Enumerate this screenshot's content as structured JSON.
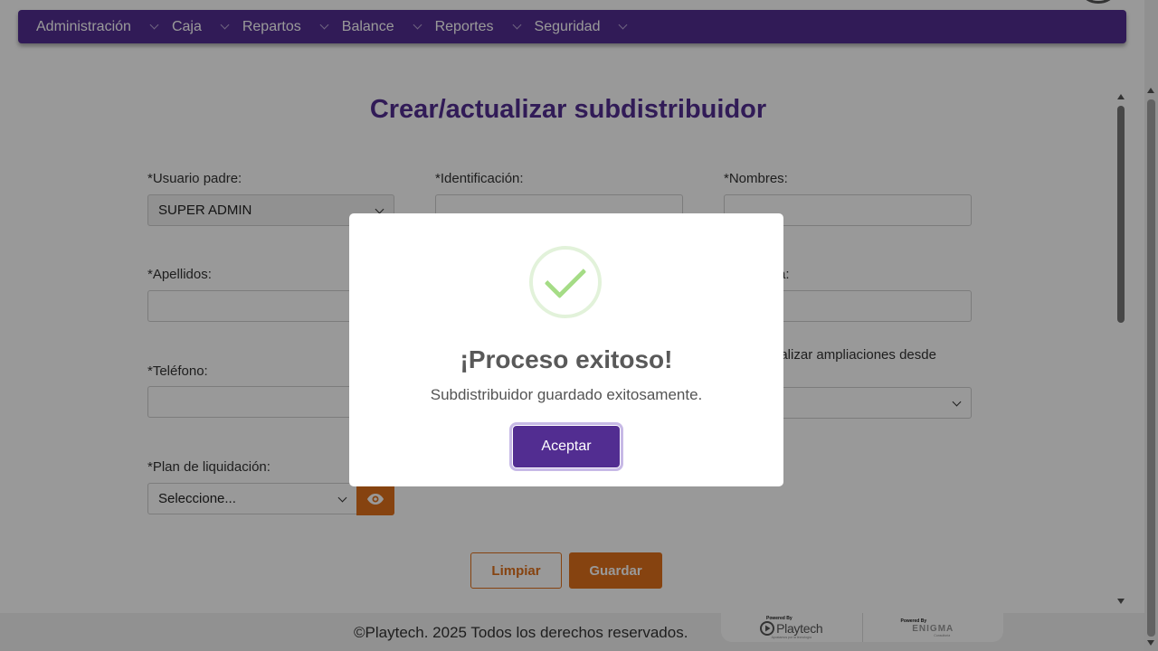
{
  "nav": {
    "items": [
      {
        "label": "Administración"
      },
      {
        "label": "Caja"
      },
      {
        "label": "Repartos"
      },
      {
        "label": "Balance"
      },
      {
        "label": "Reportes"
      },
      {
        "label": "Seguridad"
      }
    ]
  },
  "form": {
    "title": "Crear/actualizar subdistribuidor",
    "parent_user_label": "*Usuario padre:",
    "parent_user_value": "SUPER ADMIN",
    "identification_label": "*Identificación:",
    "identification_value": "",
    "names_label": "*Nombres:",
    "names_value": "",
    "lastnames_label": "*Apellidos:",
    "lastnames_value": "",
    "hidden_label_partial": "a:",
    "phone_label": "*Teléfono:",
    "phone_value": "",
    "extensions_label_partial": "ealizar ampliaciones desde",
    "plan_label": "*Plan de liquidación:",
    "plan_value": "Seleccione...",
    "clear_button": "Limpiar",
    "save_button": "Guardar"
  },
  "modal": {
    "title": "¡Proceso exitoso!",
    "message": "Subdistribuidor guardado exitosamente.",
    "accept_button": "Aceptar",
    "icon": "check-circle-icon"
  },
  "footer": {
    "copyright": "©Playtech. 2025 Todos los derechos reservados.",
    "logo1_powered": "Powered By",
    "logo1_name": "Playtech",
    "logo1_tagline": "Apostamos por la tecnología",
    "logo2_powered": "Powered By",
    "logo2_name": "ENIGMA",
    "logo2_tagline": "Consultoría"
  },
  "colors": {
    "primary": "#522d91",
    "accent": "#e0701b",
    "success": "#a5dc86"
  }
}
